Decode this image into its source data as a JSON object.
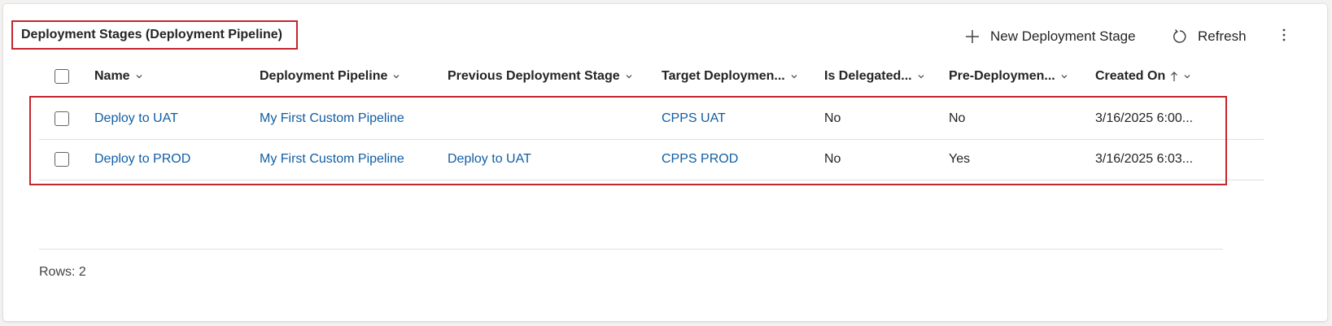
{
  "view": {
    "title": "Deployment Stages (Deployment Pipeline)"
  },
  "commands": {
    "new_label": "New Deployment Stage",
    "refresh_label": "Refresh",
    "more_icon": "more-vertical-icon"
  },
  "columns": [
    {
      "label": "Name",
      "sort": "none"
    },
    {
      "label": "Deployment Pipeline",
      "sort": "none"
    },
    {
      "label": "Previous Deployment Stage",
      "sort": "none"
    },
    {
      "label": "Target Deploymen...",
      "sort": "none"
    },
    {
      "label": "Is Delegated...",
      "sort": "none"
    },
    {
      "label": "Pre-Deploymen...",
      "sort": "none"
    },
    {
      "label": "Created On",
      "sort": "ascending"
    }
  ],
  "rows": [
    {
      "name": "Deploy to UAT",
      "pipeline": "My First Custom Pipeline",
      "previous": "",
      "target": "CPPS UAT",
      "delegated": "No",
      "pre": "No",
      "created": "3/16/2025 6:00..."
    },
    {
      "name": "Deploy to PROD",
      "pipeline": "My First Custom Pipeline",
      "previous": "Deploy to UAT",
      "target": "CPPS PROD",
      "delegated": "No",
      "pre": "Yes",
      "created": "3/16/2025 6:03..."
    }
  ],
  "footer": {
    "rows_text": "Rows: 2"
  },
  "colors": {
    "highlight": "#c4262e",
    "link": "#115ea3"
  }
}
